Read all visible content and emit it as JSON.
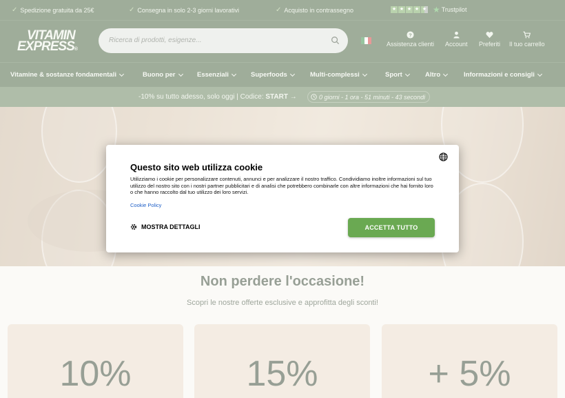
{
  "topbar": {
    "usps": [
      "Spedizione gratuita da 25€",
      "Consegna in solo 2-3 giorni lavorativi",
      "Acquisto in contrassegno"
    ],
    "trustpilot_label": "Trustpilot",
    "rating_stars": 4.5
  },
  "header": {
    "logo_line1": "VITAMIN",
    "logo_line2": "EXPRESS",
    "logo_mark": "®",
    "search_placeholder": "Ricerca di prodotti, esigenze...",
    "nav": [
      {
        "label": "Assistenza clienti",
        "icon": "help-icon"
      },
      {
        "label": "Account",
        "icon": "user-icon"
      },
      {
        "label": "Preferiti",
        "icon": "heart-icon"
      },
      {
        "label": "Il tuo carrello",
        "icon": "cart-icon"
      }
    ],
    "flag_colors": [
      "#2e8b3e",
      "#ffffff",
      "#d0302f"
    ]
  },
  "mainnav": {
    "items": [
      "Vitamine & sostanze fondamentali",
      "Buono per",
      "Essenziali",
      "Superfoods",
      "Multi-complessi",
      "Sport",
      "Altro",
      "Informazioni e consigli"
    ]
  },
  "promo": {
    "text": "-10% su tutto adesso, solo oggi | Codice: ",
    "code": "START",
    "arrow": "→",
    "timer": "0 giorni - 1 ora - 51 minuti - 43 secondi"
  },
  "section": {
    "title": "Non perdere l'occasione!",
    "subtitle": "Scopri le nostre offerte esclusive e approfitta degli sconti!",
    "cards": [
      "10%",
      "15%",
      "+ 5%"
    ]
  },
  "cookie": {
    "title": "Questo sito web utilizza cookie",
    "body": "Utilizziamo i cookie per personalizzare contenuti, annunci e per analizzare il nostro traffico. Condividiamo inoltre informazioni sul tuo utilizzo del nostro sito con i nostri partner pubblicitari e di analisi che potrebbero combinarle con altre informazioni che hai fornito loro o che hanno raccolto dal tuo utilizzo dei loro servizi.",
    "policy_link": "Cookie Policy",
    "details_button": "MOSTRA DETTAGLI",
    "accept_button": "ACCETTA TUTTO"
  },
  "colors": {
    "brand_green": "#3e5a34",
    "promo_green": "#5f7a53",
    "accept_green": "#6aa952",
    "card_beige": "#e8d9c6"
  }
}
